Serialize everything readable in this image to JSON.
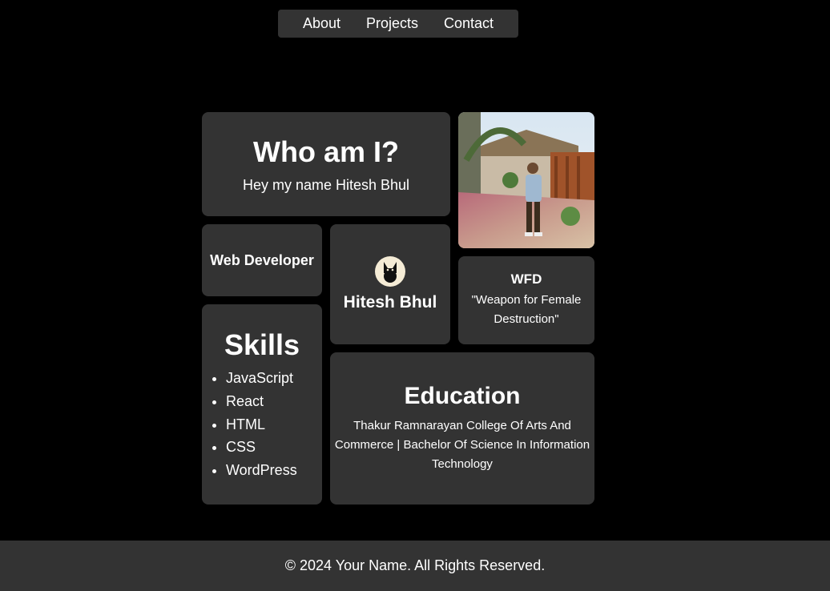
{
  "nav": {
    "items": [
      "About",
      "Projects",
      "Contact"
    ]
  },
  "who": {
    "title": "Who am I?",
    "text": "Hey my name Hitesh Bhul"
  },
  "webdev": {
    "label": "Web Developer"
  },
  "profile": {
    "name": "Hitesh Bhul"
  },
  "wfd": {
    "title": "WFD",
    "quote": "\"Weapon for Female Destruction\""
  },
  "skills": {
    "title": "Skills",
    "items": [
      "JavaScript",
      "React",
      "HTML",
      "CSS",
      "WordPress"
    ]
  },
  "education": {
    "title": "Education",
    "text": "Thakur Ramnarayan College Of Arts And Commerce | Bachelor Of Science In Information Technology"
  },
  "footer": {
    "text": "© 2024 Your Name. All Rights Reserved."
  }
}
